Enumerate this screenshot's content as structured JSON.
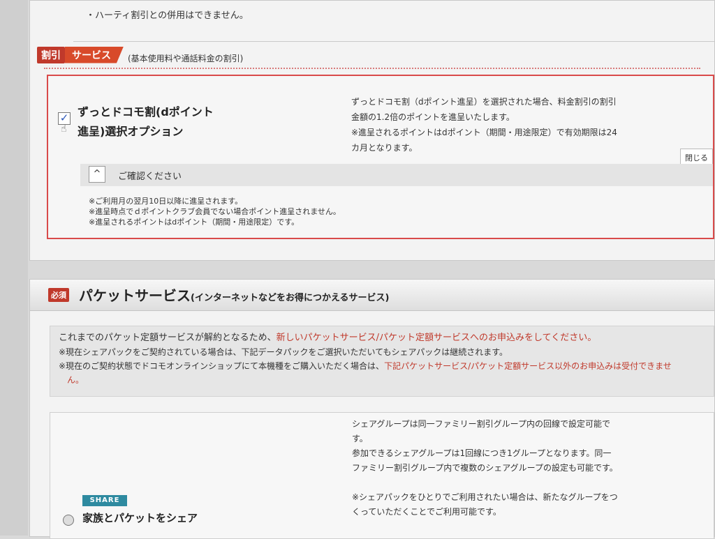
{
  "top_note": "・ハーティ割引との併用はできません。",
  "discount_section": {
    "tag1": "割引",
    "tag2": "サービス",
    "subtitle": "(基本使用料や通話料金の割引)",
    "option": {
      "checked": true,
      "checkbox_mark": "✓",
      "title": "ずっとドコモ割(dポイント進呈)選択オプション",
      "description": [
        "ずっとドコモ割（dポイント進呈）を選択された場合、料金割引の割引",
        "金額の1.2倍のポイントを進呈いたします。",
        "※進呈されるポイントはdポイント（期間・用途限定）で有効期限は24",
        "カ月となります。"
      ],
      "close_label": "閉じる"
    },
    "confirm": {
      "chevron": "^",
      "label": "ご確認ください",
      "notes": [
        "※ご利用月の翌月10日以降に進呈されます。",
        "※進呈時点でｄポイントクラブ会員でない場合ポイント進呈されません。",
        "※進呈されるポイントはdポイント（期間・用途限定）です。"
      ]
    }
  },
  "packet_section": {
    "required_tag": "必須",
    "title": "パケットサービス",
    "title_sub": "(インターネットなどをお得につかえるサービス)",
    "info": {
      "line1_normal": "これまでのパケット定額サービスが解約となるため、",
      "line1_red": "新しいパケットサービス/パケット定額サービスへのお申込みをしてください。",
      "line2": "※現在シェアパックをご契約されている場合は、下記データパックをご選択いただいてもシェアパックは継続されます。",
      "line3_normal": "※現在のご契約状態でドコモオンラインショップにて本機種をご購入いただく場合は、",
      "line3_red": "下記パケットサービス/パケット定額サービス以外のお申込みは受付できませ",
      "line4_red": "ん。"
    },
    "share": {
      "logo": "SHARE",
      "label": "家族とパケットをシェア",
      "description": [
        "シェアグループは同一ファミリー割引グループ内の回線で設定可能で",
        "す。",
        "参加できるシェアグループは1回線につき1グループとなります。同一",
        "ファミリー割引グループ内で複数のシェアグループの設定も可能です。",
        "",
        "※シェアパックをひとりでご利用されたい場合は、新たなグループをつ",
        "くっていただくことでご利用可能です。"
      ]
    }
  },
  "colors": {
    "accent_red": "#c0392b",
    "share_teal": "#2e8aa0"
  }
}
